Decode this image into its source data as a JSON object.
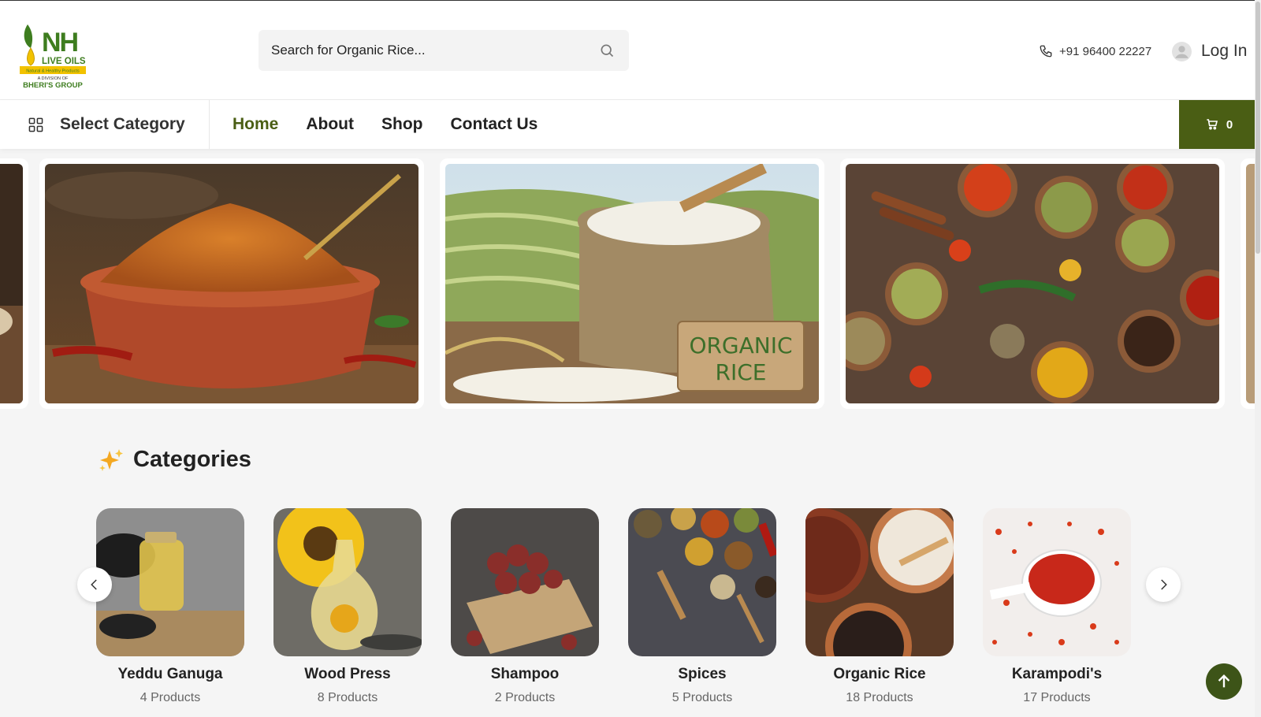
{
  "brand": {
    "logo_letters": "NH",
    "logo_line": "LIVE OILS",
    "logo_tag": "Natural & Healthy Products",
    "logo_division": "A DIVISION OF",
    "logo_group": "BHERI'S GROUP"
  },
  "search": {
    "placeholder": "Search for Organic Rice...",
    "icon": "search-icon"
  },
  "header": {
    "phone": "+91 96400 22227",
    "phone_icon": "phone-icon",
    "login_label": "Log In",
    "login_icon": "user-avatar-icon"
  },
  "nav": {
    "select_category": "Select Category",
    "links": [
      {
        "label": "Home",
        "active": true
      },
      {
        "label": "About",
        "active": false
      },
      {
        "label": "Shop",
        "active": false
      },
      {
        "label": "Contact Us",
        "active": false
      }
    ],
    "cart_count": "0",
    "cart_icon": "cart-icon"
  },
  "banners": [
    {
      "name": "partial-banner-left"
    },
    {
      "name": "karampodi-banner"
    },
    {
      "name": "organic-rice-banner",
      "text_line1": "ORGANIC",
      "text_line2": "RICE"
    },
    {
      "name": "spices-banner"
    },
    {
      "name": "partial-banner-right"
    }
  ],
  "categories": {
    "heading": "Categories",
    "heading_icon": "sparkles-icon",
    "items": [
      {
        "name": "Yeddu Ganuga",
        "count": "4 Products"
      },
      {
        "name": "Wood Press",
        "count": "8 Products"
      },
      {
        "name": "Shampoo",
        "count": "2 Products"
      },
      {
        "name": "Spices",
        "count": "5 Products"
      },
      {
        "name": "Organic Rice",
        "count": "18 Products"
      },
      {
        "name": "Karampodi's",
        "count": "17 Products"
      }
    ]
  },
  "colors": {
    "brand_green": "#4a5e14",
    "accent_yellow": "#f2c200"
  }
}
